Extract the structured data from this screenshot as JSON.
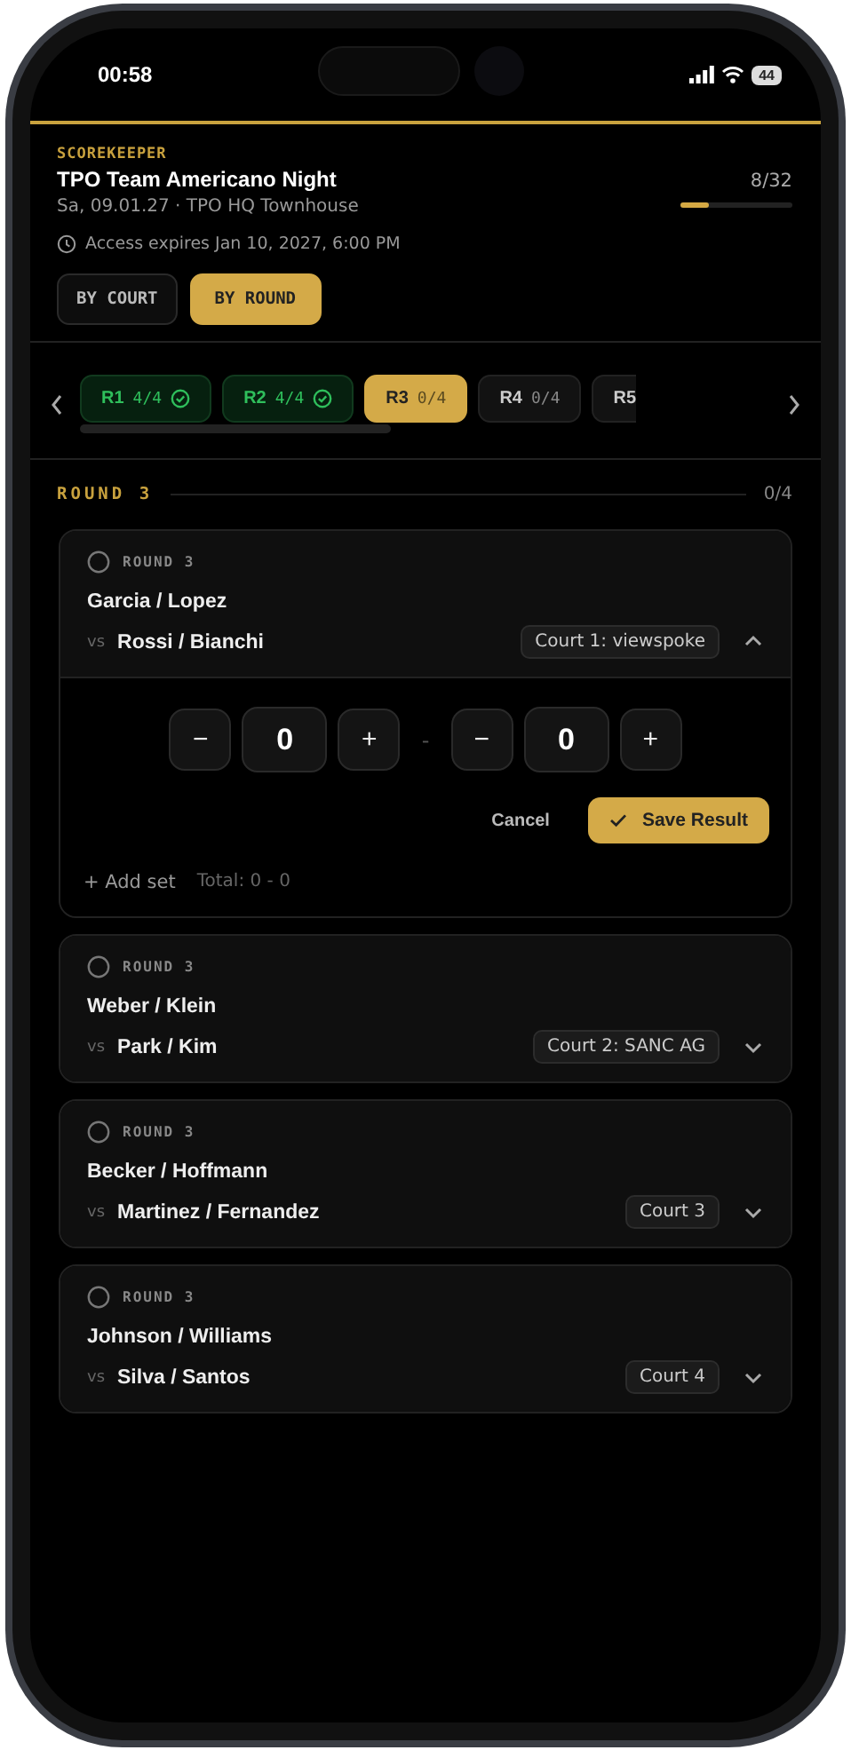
{
  "status_bar": {
    "time": "00:58",
    "battery": "44"
  },
  "header": {
    "role": "SCOREKEEPER",
    "title": "TPO Team Americano Night",
    "subtitle": "Sa, 09.01.27 · TPO HQ Townhouse",
    "progress_text": "8/32",
    "level": 0.25,
    "access": "Access expires Jan 10, 2027, 6:00 PM"
  },
  "view_toggle": [
    {
      "label": "BY COURT",
      "selected": false
    },
    {
      "label": "BY ROUND",
      "selected": true
    }
  ],
  "round_tabs": [
    {
      "label": "R1",
      "count": "4/4",
      "complete": true,
      "selected": false
    },
    {
      "label": "R2",
      "count": "4/4",
      "complete": true,
      "selected": false
    },
    {
      "label": "R3",
      "count": "0/4",
      "complete": false,
      "selected": true
    },
    {
      "label": "R4",
      "count": "0/4",
      "complete": false,
      "selected": false
    },
    {
      "label": "R5",
      "complete": false,
      "selected": false
    }
  ],
  "section": {
    "title": "ROUND 3",
    "count": "0/4"
  },
  "matches": [
    {
      "round": "ROUND 3",
      "team_a": "Garcia / Lopez",
      "vs": "vs",
      "team_b": "Rossi / Bianchi",
      "court": "Court 1: viewspoke",
      "expanded": true,
      "editor": {
        "minus": "−",
        "plus": "+",
        "score_a": "0",
        "score_b": "0",
        "separator": "-",
        "cancel": "Cancel",
        "save": "Save Result",
        "add_set": "+ Add set",
        "total": "Total: 0 - 0"
      }
    },
    {
      "round": "ROUND 3",
      "team_a": "Weber / Klein",
      "vs": "vs",
      "team_b": "Park / Kim",
      "court": "Court 2: SANC AG",
      "expanded": false
    },
    {
      "round": "ROUND 3",
      "team_a": "Becker / Hoffmann",
      "vs": "vs",
      "team_b": "Martinez / Fernandez",
      "court": "Court 3",
      "expanded": false
    },
    {
      "round": "ROUND 3",
      "team_a": "Johnson / Williams",
      "vs": "vs",
      "team_b": "Silva / Santos",
      "court": "Court 4",
      "expanded": false
    }
  ]
}
